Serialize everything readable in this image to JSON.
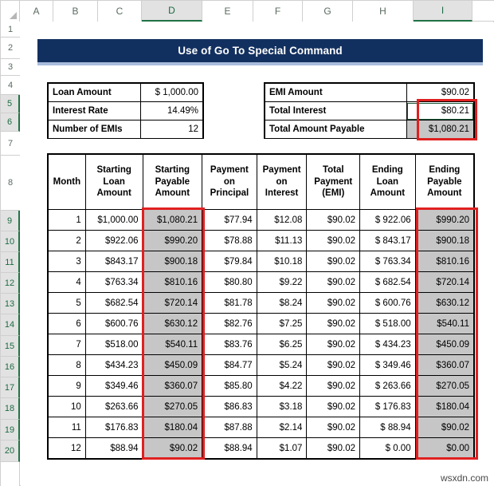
{
  "spreadsheet": {
    "column_headers": [
      "A",
      "B",
      "C",
      "D",
      "E",
      "F",
      "G",
      "H",
      "I"
    ],
    "selected_columns": [
      "D",
      "I"
    ],
    "row_headers": [
      "1",
      "2",
      "3",
      "4",
      "5",
      "6",
      "7",
      "8",
      "9",
      "10",
      "11",
      "12",
      "13",
      "14",
      "15",
      "16",
      "17",
      "18",
      "19",
      "20"
    ],
    "selected_rows": [
      "5",
      "6",
      "9",
      "10",
      "11",
      "12",
      "13",
      "14",
      "15",
      "16",
      "17",
      "18",
      "19",
      "20"
    ],
    "accent_color": "#217346",
    "selection_outline_color": "#e02020",
    "shaded_cell_color": "#c6c6c6"
  },
  "title": {
    "text": "Use of Go To Special Command",
    "background": "#12305f",
    "underline_color": "#a8bcdc"
  },
  "loan_info": {
    "rows": [
      {
        "label": "Loan Amount",
        "value": "$ 1,000.00"
      },
      {
        "label": "Interest Rate",
        "value": "14.49%"
      },
      {
        "label": "Number of EMIs",
        "value": "12"
      }
    ]
  },
  "summary_info": {
    "rows": [
      {
        "label": "EMI Amount",
        "value": "$90.02"
      },
      {
        "label": "Total Interest",
        "value": "$80.21"
      },
      {
        "label": "Total Amount Payable",
        "value": "$1,080.21"
      }
    ]
  },
  "amortization": {
    "headers": [
      "Month",
      "Starting Loan Amount",
      "Starting Payable Amount",
      "Payment on Principal",
      "Payment on Interest",
      "Total Payment (EMI)",
      "Ending Loan Amount",
      "Ending Payable Amount"
    ],
    "header_lines": [
      [
        "Month"
      ],
      [
        "Starting",
        "Loan",
        "Amount"
      ],
      [
        "Starting",
        "Payable",
        "Amount"
      ],
      [
        "Payment",
        "on",
        "Principal"
      ],
      [
        "Payment",
        "on",
        "Interest"
      ],
      [
        "Total",
        "Payment",
        "(EMI)"
      ],
      [
        "Ending",
        "Loan",
        "Amount"
      ],
      [
        "Ending",
        "Payable",
        "Amount"
      ]
    ],
    "rows": [
      [
        "1",
        "$1,000.00",
        "$1,080.21",
        "$77.94",
        "$12.08",
        "$90.02",
        "$ 922.06",
        "$990.20"
      ],
      [
        "2",
        "$922.06",
        "$990.20",
        "$78.88",
        "$11.13",
        "$90.02",
        "$ 843.17",
        "$900.18"
      ],
      [
        "3",
        "$843.17",
        "$900.18",
        "$79.84",
        "$10.18",
        "$90.02",
        "$ 763.34",
        "$810.16"
      ],
      [
        "4",
        "$763.34",
        "$810.16",
        "$80.80",
        "$9.22",
        "$90.02",
        "$ 682.54",
        "$720.14"
      ],
      [
        "5",
        "$682.54",
        "$720.14",
        "$81.78",
        "$8.24",
        "$90.02",
        "$ 600.76",
        "$630.12"
      ],
      [
        "6",
        "$600.76",
        "$630.12",
        "$82.76",
        "$7.25",
        "$90.02",
        "$ 518.00",
        "$540.11"
      ],
      [
        "7",
        "$518.00",
        "$540.11",
        "$83.76",
        "$6.25",
        "$90.02",
        "$ 434.23",
        "$450.09"
      ],
      [
        "8",
        "$434.23",
        "$450.09",
        "$84.77",
        "$5.24",
        "$90.02",
        "$ 349.46",
        "$360.07"
      ],
      [
        "9",
        "$349.46",
        "$360.07",
        "$85.80",
        "$4.22",
        "$90.02",
        "$ 263.66",
        "$270.05"
      ],
      [
        "10",
        "$263.66",
        "$270.05",
        "$86.83",
        "$3.18",
        "$90.02",
        "$ 176.83",
        "$180.04"
      ],
      [
        "11",
        "$176.83",
        "$180.04",
        "$87.88",
        "$2.14",
        "$90.02",
        "$  88.94",
        "$90.02"
      ],
      [
        "12",
        "$88.94",
        "$90.02",
        "$88.94",
        "$1.07",
        "$90.02",
        "$   0.00",
        "$0.00"
      ]
    ],
    "shaded_column_indexes": [
      2,
      7
    ]
  },
  "watermark": {
    "text": "wsxdn.com"
  }
}
